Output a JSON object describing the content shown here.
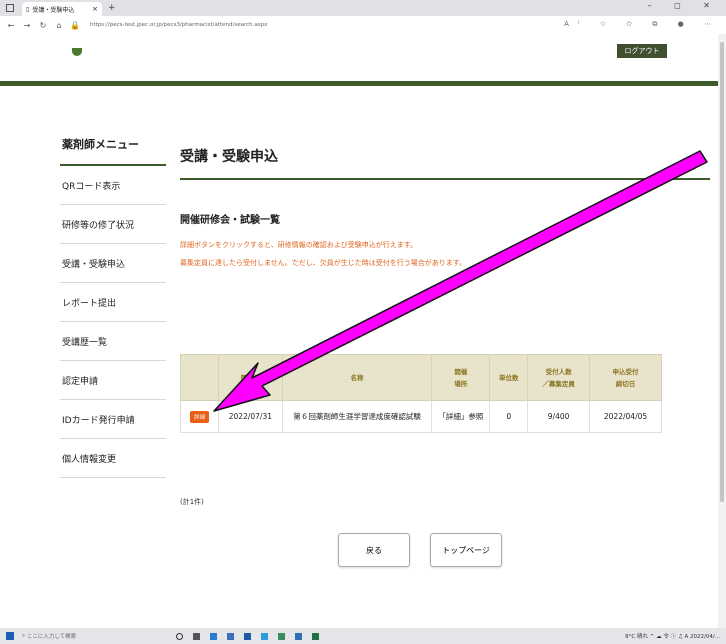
{
  "browser": {
    "tab_title": "受講・受験申込",
    "tab_close": "×",
    "new_tab": "+",
    "url": "https://pecs-test.jpec.or.jp/pecs3/pharmacist/attend/search.aspx",
    "window_controls": "–  ◻  ✕"
  },
  "header": {
    "logout_label": "ログアウト"
  },
  "sidebar": {
    "title": "薬剤師メニュー",
    "items": [
      {
        "label": "QRコード表示"
      },
      {
        "label": "研修等の修了状況"
      },
      {
        "label": "受講・受験申込"
      },
      {
        "label": "レポート提出"
      },
      {
        "label": "受講歴一覧"
      },
      {
        "label": "認定申請"
      },
      {
        "label": "IDカード発行申請"
      },
      {
        "label": "個人情報変更"
      }
    ]
  },
  "main": {
    "page_title": "受講・受験申込",
    "section_heading": "開催研修会・試験一覧",
    "note1": "詳細ボタンをクリックすると、研修情報の確認および受験申込が行えます。",
    "note2": "募集定員に達したら受付しません。ただし、欠員が生じた時は受付を行う場合があります。",
    "table": {
      "headers": [
        "",
        "開催日",
        "名称",
        "開催\n場所",
        "単位数",
        "受付人数\n／募集定員",
        "申込受付\n締切日"
      ],
      "rows": [
        {
          "detail_label": "詳細",
          "date": "2022/07/31",
          "name": "第６回薬剤師生涯学習達成度確認試験",
          "place": "「詳細」参照",
          "units": "0",
          "capacity": "9/400",
          "deadline": "2022/04/05"
        }
      ]
    },
    "count": "(計1件)",
    "back_label": "戻る",
    "top_label": "トップページ"
  },
  "taskbar": {
    "search_placeholder": "ここに入力して検索",
    "tray_text": "8°C 晴れ  ^  ☁ 令 ⓘ ♫  A  2022/04/..."
  },
  "colors": {
    "accent_green": "#3d5a2a",
    "note_orange": "#e0651d",
    "detail_button": "#e85f15",
    "table_header_bg": "#e8e3cb",
    "arrow_fill": "#ff00ff"
  }
}
